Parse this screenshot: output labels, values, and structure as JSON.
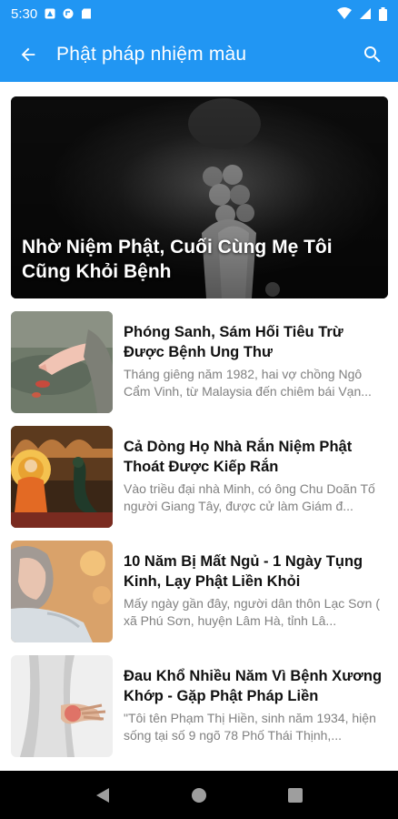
{
  "status": {
    "time": "5:30"
  },
  "appbar": {
    "title": "Phật pháp nhiệm màu"
  },
  "featured": {
    "title": "Nhờ Niệm Phật, Cuối Cùng Mẹ Tôi Cũng Khỏi Bệnh"
  },
  "articles": [
    {
      "title": "Phóng Sanh, Sám Hối Tiêu Trừ Được Bệnh Ung Thư",
      "desc": "Tháng giêng năm 1982, hai vợ chồng Ngô Cẩm Vinh, từ Malaysia đến chiêm bái Vạn..."
    },
    {
      "title": "Cả Dòng Họ Nhà Rắn Niệm Phật Thoát Được Kiếp Rắn",
      "desc": "Vào triều đại nhà Minh, có ông Chu Doãn Tố người Giang Tây, được cử làm Giám đ..."
    },
    {
      "title": "10 Năm Bị Mất Ngủ - 1 Ngày Tụng Kinh, Lạy Phật Liền Khỏi",
      "desc": "Mấy ngày gần đây, người dân thôn Lạc Sơn ( xã Phú Sơn, huyện Lâm Hà, tỉnh Lâ..."
    },
    {
      "title": "Đau Khổ Nhiều Năm Vì Bệnh Xương Khớp - Gặp Phật Pháp Liền",
      "desc": "\"Tôi tên Phạm Thị Hiền, sinh năm 1934, hiện sống tại số 9 ngõ 78 Phố Thái Thịnh,..."
    }
  ],
  "icons": {
    "back": "arrow-back-icon",
    "search": "search-icon",
    "nav_back": "triangle-back-icon",
    "nav_home": "circle-home-icon",
    "nav_recents": "square-recents-icon"
  },
  "colors": {
    "appbar": "#2196f3",
    "title_text": "#111111",
    "desc_text": "#808080",
    "navbar": "#000000"
  }
}
